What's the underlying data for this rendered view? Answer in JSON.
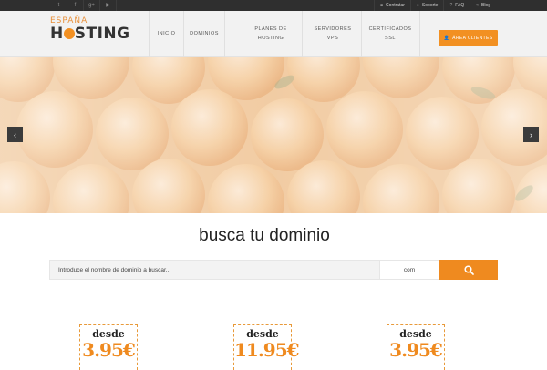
{
  "topbar": {
    "social": [
      {
        "icon": "twitter-icon",
        "glyph": "t"
      },
      {
        "icon": "facebook-icon",
        "glyph": "f"
      },
      {
        "icon": "googleplus-icon",
        "glyph": "g+"
      },
      {
        "icon": "youtube-icon",
        "glyph": "▶"
      }
    ],
    "links": [
      {
        "icon": "cart-icon",
        "glyph": "■",
        "label": "Contratar"
      },
      {
        "icon": "support-icon",
        "glyph": "●",
        "label": "Soporte"
      },
      {
        "icon": "question-icon",
        "glyph": "?",
        "label": "FAQ"
      },
      {
        "icon": "rss-icon",
        "glyph": "≈",
        "label": "Blog"
      }
    ]
  },
  "header": {
    "logo_top": "ESPAÑA",
    "logo_bottom_pre": "H",
    "logo_bottom_post": "STING",
    "nav": [
      {
        "label": "INICIO"
      },
      {
        "label": "DOMINIOS"
      },
      {
        "label": "PLANES DE HOSTING"
      },
      {
        "label": "SERVIDORES VPS"
      },
      {
        "label": "CERTIFICADOS SSL"
      }
    ],
    "area_button": "ÁREA CLIENTES",
    "colors": {
      "accent": "#f29022",
      "dark": "#2f2f2f"
    }
  },
  "slider": {
    "prev": "‹",
    "next": "›"
  },
  "search": {
    "title": "busca tu dominio",
    "placeholder": "Introduce el nombre de dominio a buscar...",
    "tld": "com"
  },
  "prices": [
    {
      "label": "desde",
      "value": "3.95€"
    },
    {
      "label": "desde",
      "value": "11.95€"
    },
    {
      "label": "desde",
      "value": "3.95€"
    }
  ]
}
